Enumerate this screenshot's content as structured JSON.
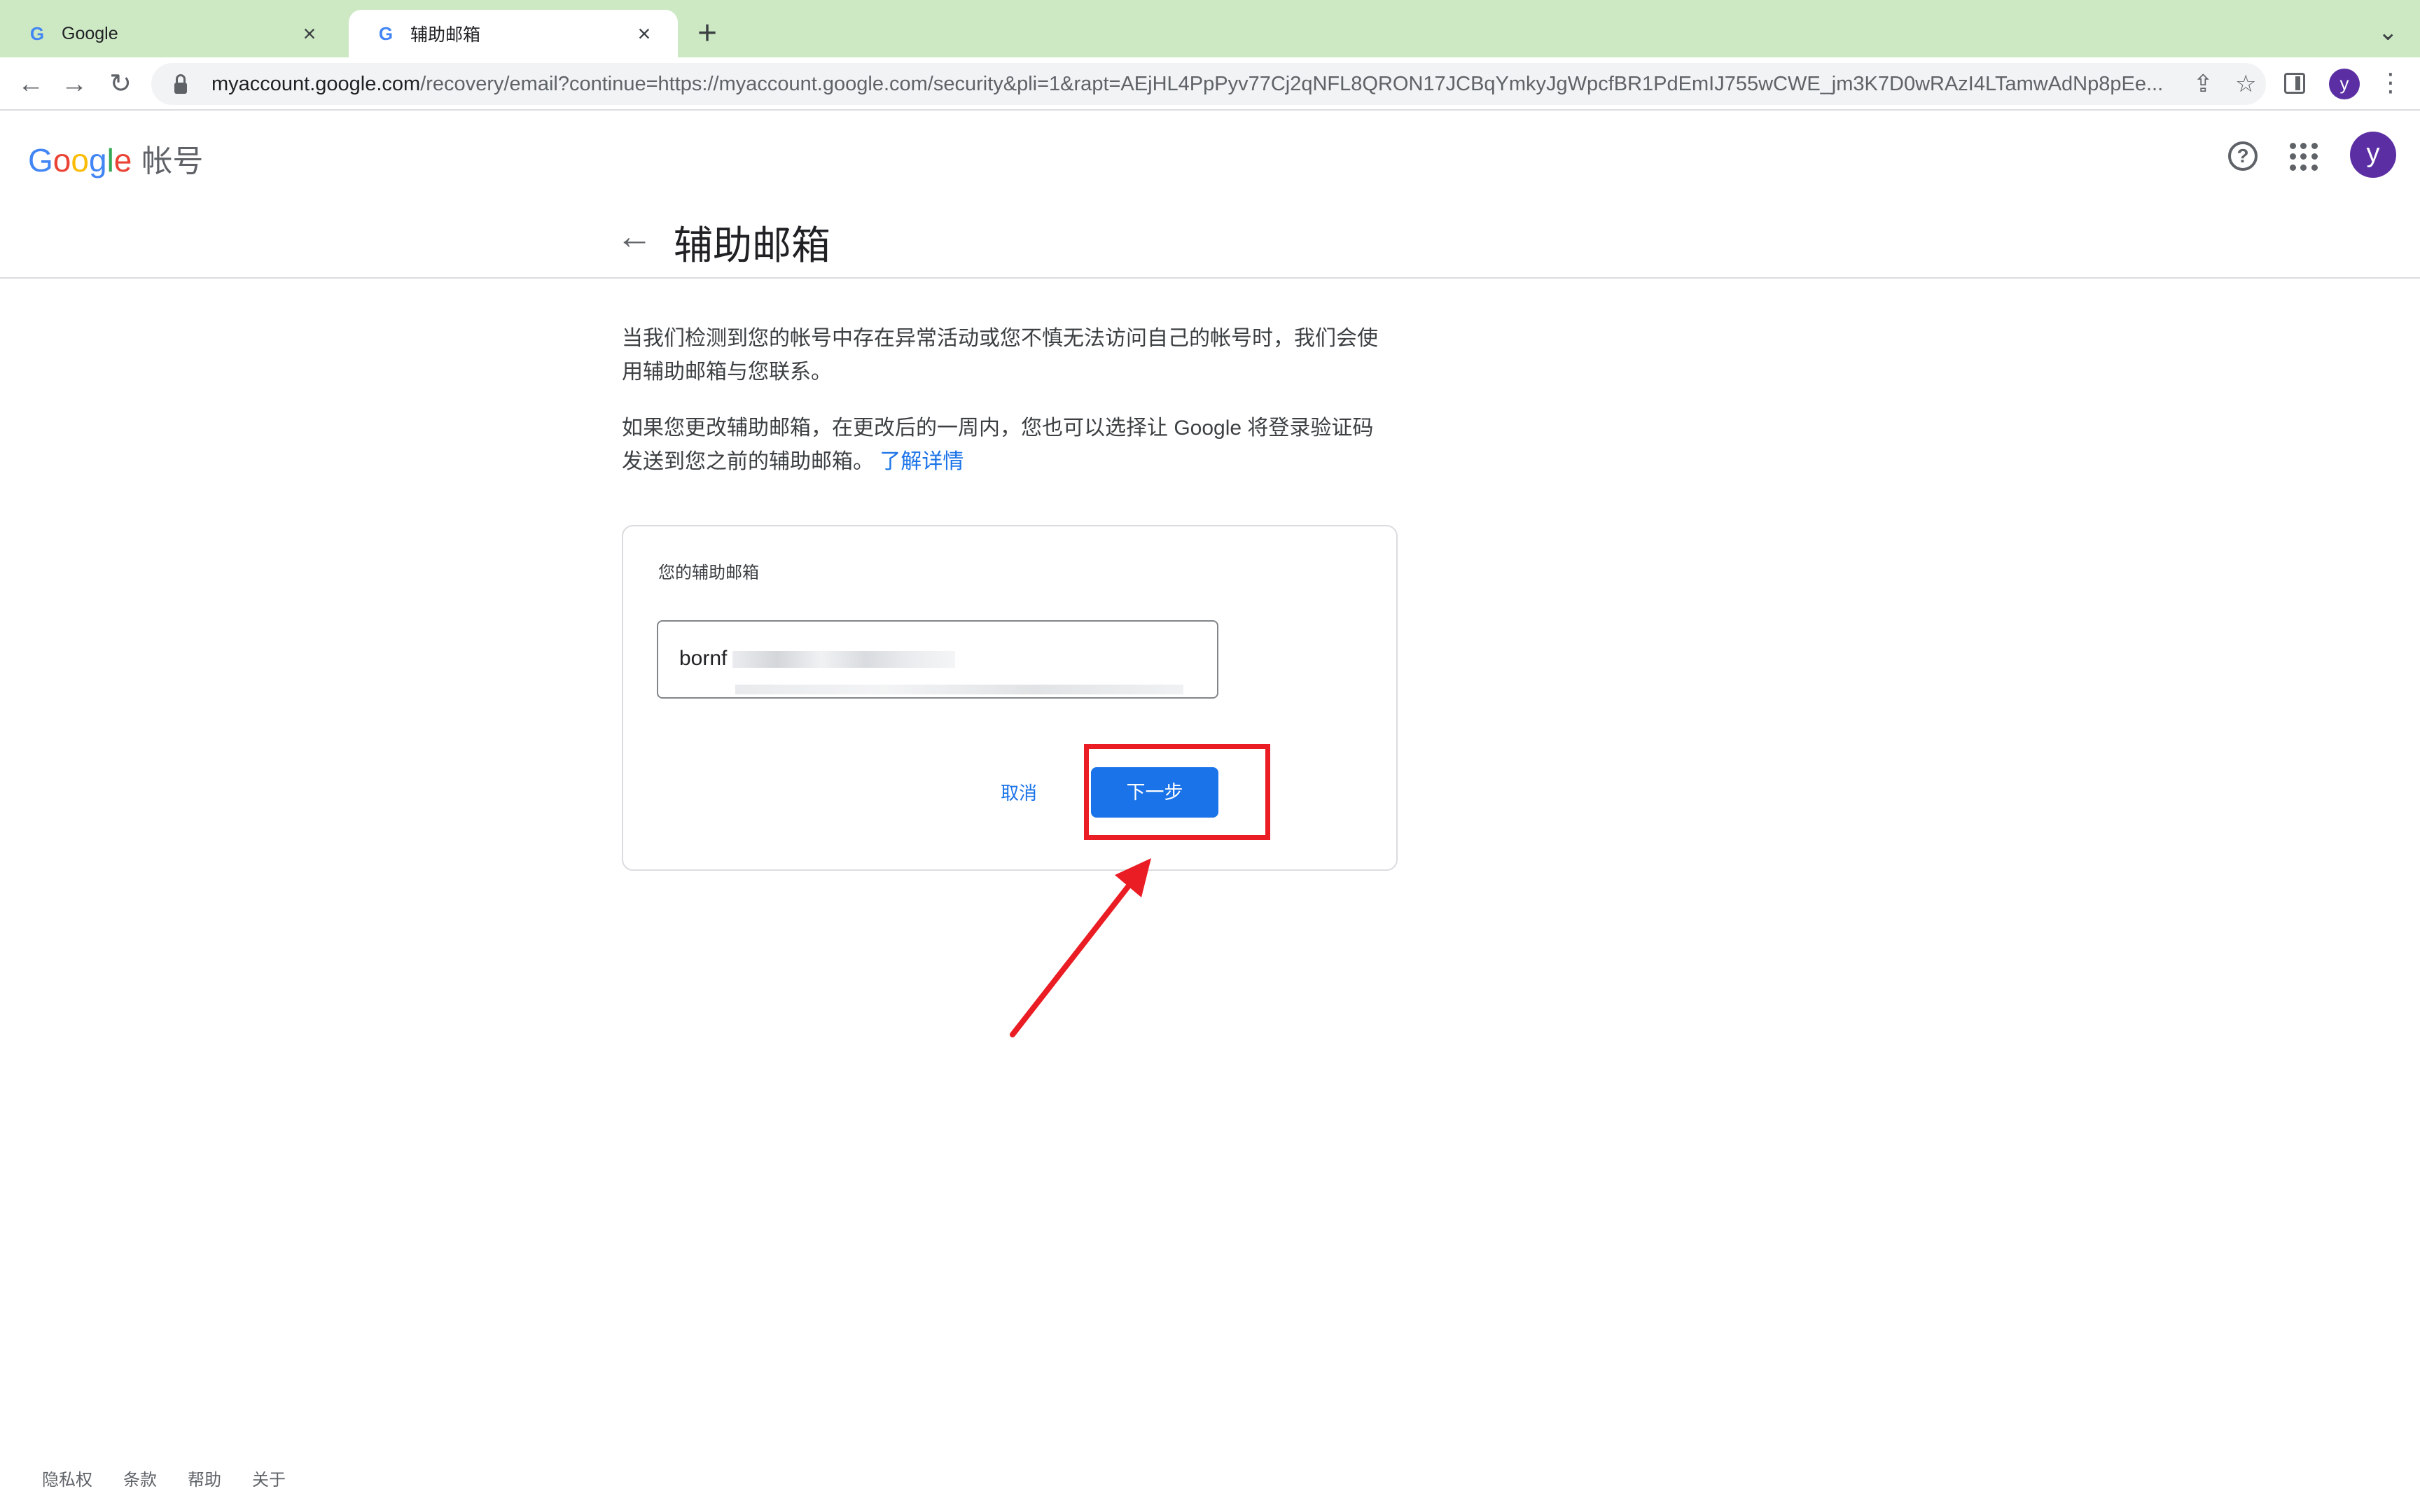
{
  "browser": {
    "tabs": [
      {
        "title": "Google",
        "active": false
      },
      {
        "title": "辅助邮箱",
        "active": true
      }
    ],
    "new_tab": "+",
    "tab_search": "⌄",
    "nav": {
      "back": "←",
      "forward": "→",
      "reload": "↻"
    },
    "url": {
      "host": "myaccount.google.com",
      "path": "/recovery/email?continue=https://myaccount.google.com/security&pli=1&rapt=AEjHL4PpPyv77Cj2qNFL8QRON17JCBqYmkyJgWpcfBR1PdEmIJ755wCWE_jm3K7D0wRAzI4LTamwAdNp8pEe..."
    },
    "share_icon": "⇪",
    "star_icon": "☆",
    "profile_letter": "y",
    "menu_icon": "⋮"
  },
  "header": {
    "logo_letters": [
      {
        "ch": "G",
        "color": "#4285F4"
      },
      {
        "ch": "o",
        "color": "#EA4335"
      },
      {
        "ch": "o",
        "color": "#FBBC05"
      },
      {
        "ch": "g",
        "color": "#4285F4"
      },
      {
        "ch": "l",
        "color": "#34A853"
      },
      {
        "ch": "e",
        "color": "#EA4335"
      }
    ],
    "product_name": "帐号",
    "help_icon": "?",
    "avatar_letter": "y"
  },
  "page": {
    "back_icon": "←",
    "title": "辅助邮箱",
    "para1": "当我们检测到您的帐号中存在异常活动或您不慎无法访问自己的帐号时，我们会使用辅助邮箱与您联系。",
    "para2": "如果您更改辅助邮箱，在更改后的一周内，您也可以选择让 Google 将登录验证码发送到您之前的辅助邮箱。",
    "learn_more": "了解详情"
  },
  "card": {
    "label": "您的辅助邮箱",
    "email_visible": "bornf",
    "cancel_label": "取消",
    "next_label": "下一步"
  },
  "footer": [
    "隐私权",
    "条款",
    "帮助",
    "关于"
  ],
  "colors": {
    "tabstrip": "#cde9c4",
    "accent": "#1a73e8",
    "annotation": "#ea1c24",
    "avatar": "#5b2fa3"
  }
}
